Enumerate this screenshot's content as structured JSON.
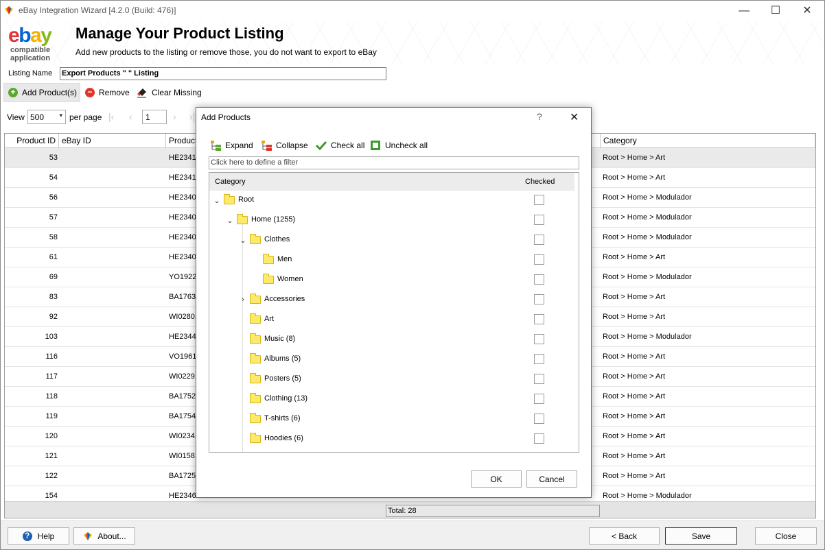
{
  "window": {
    "title": "eBay Integration Wizard [4.2.0 (Build: 476)]",
    "minimize": "—",
    "maximize": "☐",
    "close": "✕"
  },
  "header": {
    "logo_text_1": "compatible",
    "logo_text_2": "application",
    "title": "Manage Your Product Listing",
    "subtitle": "Add new products to the listing or remove those, you do not want to export to eBay"
  },
  "listing": {
    "label": "Listing Name",
    "value": "Export Products \"                          \" Listing"
  },
  "toolbar": {
    "add_label": "Add Product(s)",
    "remove_label": "Remove",
    "clear_label": "Clear Missing"
  },
  "pager": {
    "view_label": "View",
    "page_size": "500",
    "per_page_label": "per page",
    "page_number": "1"
  },
  "grid": {
    "headers": {
      "product_id": "Product ID",
      "ebay_id": "eBay ID",
      "product": "Product",
      "category": "Category"
    },
    "rows": [
      {
        "id": "53",
        "sku": "HE23411",
        "category": "Root > Home > Art"
      },
      {
        "id": "54",
        "sku": "HE23412",
        "category": "Root > Home > Art"
      },
      {
        "id": "56",
        "sku": "HE23400",
        "category": "Root > Home > Modulador"
      },
      {
        "id": "57",
        "sku": "HE23401",
        "category": "Root > Home > Modulador"
      },
      {
        "id": "58",
        "sku": "HE23402",
        "category": "Root > Home > Modulador"
      },
      {
        "id": "61",
        "sku": "HE23405",
        "category": "Root > Home > Art"
      },
      {
        "id": "69",
        "sku": "YO1922",
        "category": "Root > Home > Modulador"
      },
      {
        "id": "83",
        "sku": "BA17639",
        "category": "Root > Home > Art"
      },
      {
        "id": "92",
        "sku": "WI02801",
        "category": "Root > Home > Art"
      },
      {
        "id": "103",
        "sku": "HE23443",
        "category": "Root > Home > Modulador"
      },
      {
        "id": "116",
        "sku": "VO1961",
        "category": "Root > Home > Art"
      },
      {
        "id": "117",
        "sku": "WI02291",
        "category": "Root > Home > Art"
      },
      {
        "id": "118",
        "sku": "BA17523",
        "category": "Root > Home > Art"
      },
      {
        "id": "119",
        "sku": "BA17541",
        "category": "Root > Home > Art"
      },
      {
        "id": "120",
        "sku": "WI02341",
        "category": "Root > Home > Art"
      },
      {
        "id": "121",
        "sku": "WI01581",
        "category": "Root > Home > Art"
      },
      {
        "id": "122",
        "sku": "BA17250",
        "category": "Root > Home > Art"
      },
      {
        "id": "154",
        "sku": "HE23461",
        "category": "Root > Home > Modulador"
      }
    ],
    "total": "Total: 28"
  },
  "bottom": {
    "help": "Help",
    "about": "About...",
    "back": "< Back",
    "save": "Save",
    "close": "Close"
  },
  "dialog": {
    "title": "Add Products",
    "help": "?",
    "close": "✕",
    "expand": "Expand",
    "collapse": "Collapse",
    "check_all": "Check all",
    "uncheck_all": "Uncheck all",
    "filter_placeholder": "Click here to define a filter",
    "col_category": "Category",
    "col_checked": "Checked",
    "tree": [
      {
        "label": "Root",
        "expander": "⌄",
        "checked": false
      },
      {
        "label": "Home (1255)",
        "expander": "⌄",
        "checked": false
      },
      {
        "label": "Clothes",
        "expander": "⌄",
        "checked": false
      },
      {
        "label": "Men",
        "expander": "",
        "checked": false
      },
      {
        "label": "Women",
        "expander": "",
        "checked": false
      },
      {
        "label": "Accessories",
        "expander": "›",
        "checked": false
      },
      {
        "label": "Art",
        "expander": "",
        "checked": false
      },
      {
        "label": "Music (8)",
        "expander": "",
        "checked": false
      },
      {
        "label": "Albums (5)",
        "expander": "",
        "checked": false
      },
      {
        "label": "Posters (5)",
        "expander": "",
        "checked": false
      },
      {
        "label": "Clothing (13)",
        "expander": "",
        "checked": false
      },
      {
        "label": "T-shirts (6)",
        "expander": "",
        "checked": false
      },
      {
        "label": "Hoodies (6)",
        "expander": "",
        "checked": false
      }
    ],
    "ok": "OK",
    "cancel": "Cancel"
  }
}
